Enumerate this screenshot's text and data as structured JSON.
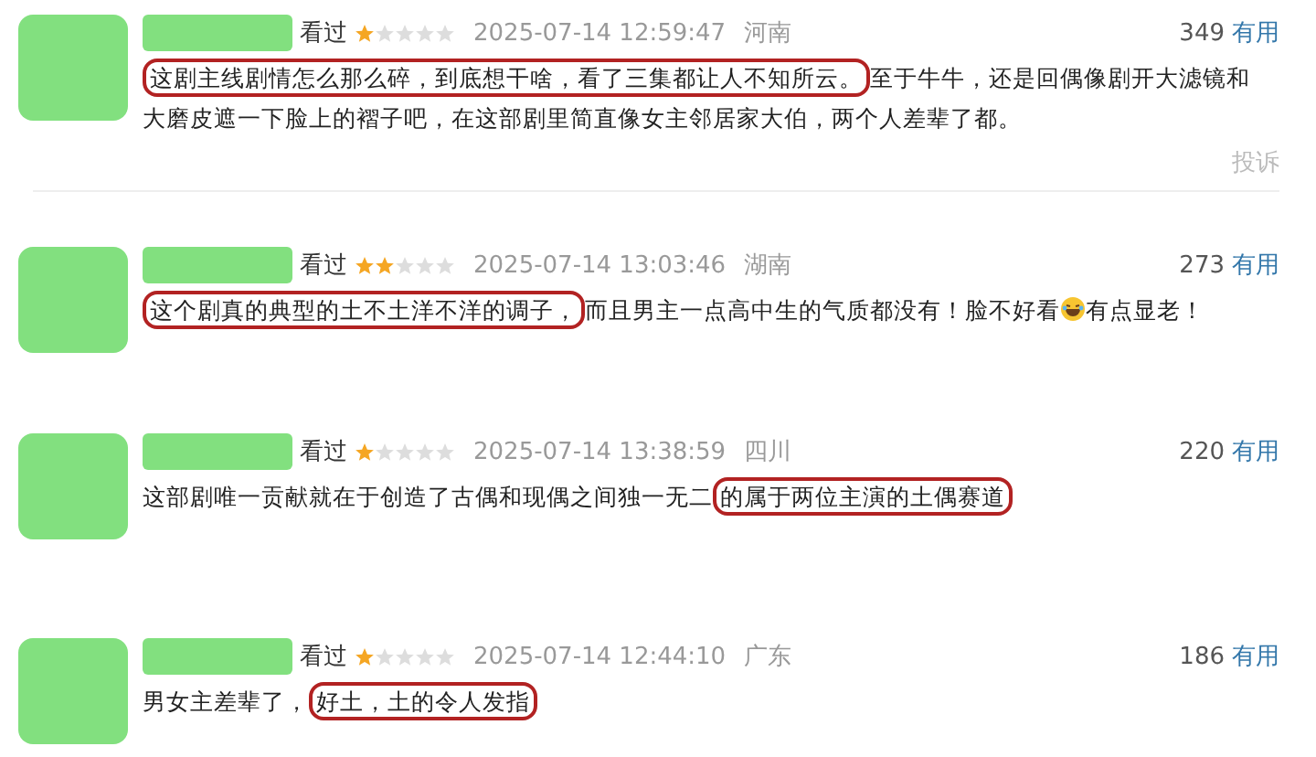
{
  "comments": [
    {
      "status": "看过",
      "stars": 1,
      "time": "2025-07-14 12:59:47",
      "region": "河南",
      "votes": "349",
      "vote_label": "有用",
      "report": "投诉",
      "segments": [
        {
          "kind": "text",
          "text": "这剧主线剧情怎么那么碎，到底想干啥，看了三集都让人不知所云。",
          "circled": true
        },
        {
          "kind": "text",
          "text": "至于牛牛，还是回偶像剧开大滤镜和大磨皮遮一下脸上的褶子吧，在这部剧里简直像女主邻居家大伯，两个人差辈了都。",
          "circled": false
        }
      ]
    },
    {
      "status": "看过",
      "stars": 2,
      "time": "2025-07-14 13:03:46",
      "region": "湖南",
      "votes": "273",
      "vote_label": "有用",
      "segments": [
        {
          "kind": "text",
          "text": "这个剧真的典型的土不土洋不洋的调子，",
          "circled": true
        },
        {
          "kind": "text",
          "text": "而且男主一点高中生的气质都没有！脸不好看",
          "circled": false
        },
        {
          "kind": "emoji"
        },
        {
          "kind": "text",
          "text": "有点显老！",
          "circled": false
        }
      ]
    },
    {
      "status": "看过",
      "stars": 1,
      "time": "2025-07-14 13:38:59",
      "region": "四川",
      "votes": "220",
      "vote_label": "有用",
      "segments": [
        {
          "kind": "text",
          "text": "这部剧唯一贡献就在于创造了古偶和现偶之间独一无二",
          "circled": false
        },
        {
          "kind": "text",
          "text": "的属于两位主演的土偶赛道",
          "circled": true
        }
      ]
    },
    {
      "status": "看过",
      "stars": 1,
      "time": "2025-07-14 12:44:10",
      "region": "广东",
      "votes": "186",
      "vote_label": "有用",
      "segments": [
        {
          "kind": "text",
          "text": "男女主差辈了，",
          "circled": false
        },
        {
          "kind": "text",
          "text": "好土，土的令人发指",
          "circled": true
        }
      ]
    }
  ]
}
